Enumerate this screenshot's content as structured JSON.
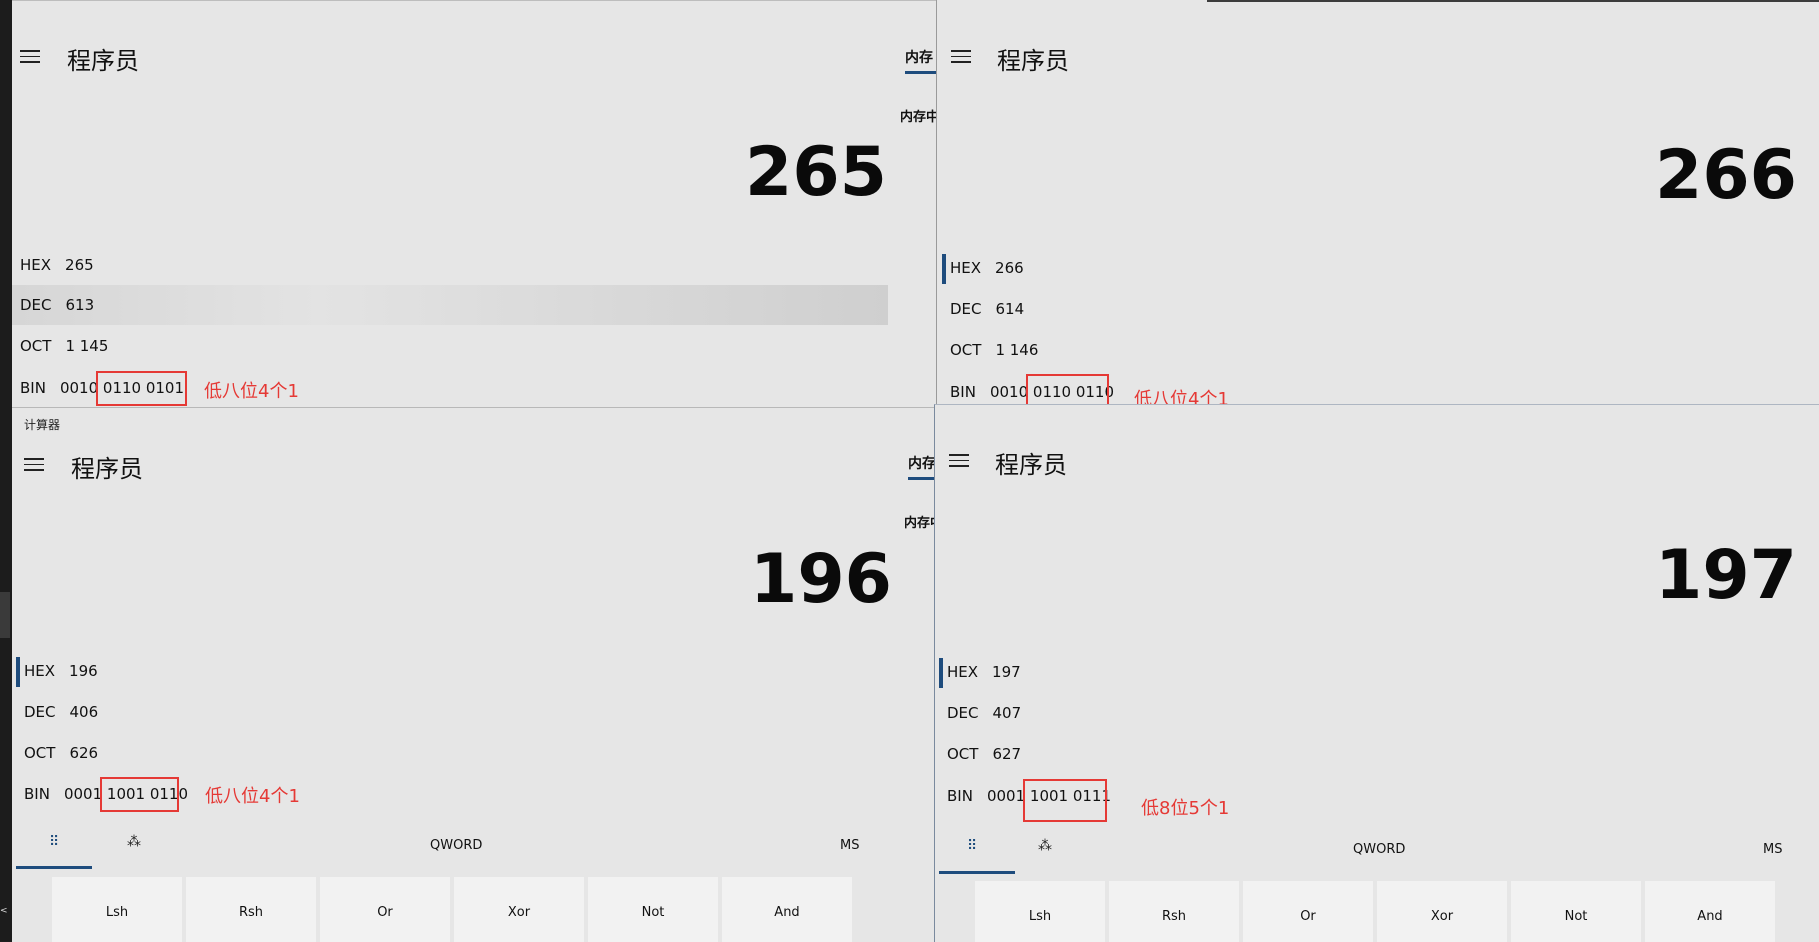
{
  "app_title": "计算器",
  "mode_title": "程序员",
  "memory_tab": "内存",
  "memory_empty": "内存中",
  "labels": {
    "hex": "HEX",
    "dec": "DEC",
    "oct": "OCT",
    "bin": "BIN"
  },
  "panels": {
    "tl": {
      "display": "265",
      "hex": "265",
      "dec": "613",
      "oct": "1 145",
      "bin_high": "0010",
      "bin_low": "0110 0101",
      "annotation": "低八位4个1"
    },
    "tr": {
      "display": "266",
      "hex": "266",
      "dec": "614",
      "oct": "1 146",
      "bin_high": "0010",
      "bin_low": "0110 0110",
      "annotation": "低八位4个1"
    },
    "bl": {
      "display": "196",
      "hex": "196",
      "dec": "406",
      "oct": "626",
      "bin_high": "0001",
      "bin_low": "1001 0110",
      "annotation": "低八位4个1"
    },
    "br": {
      "display": "197",
      "hex": "197",
      "dec": "407",
      "oct": "627",
      "bin_high": "0001",
      "bin_low": "1001 0111",
      "annotation": "低8位5个1"
    }
  },
  "toolbar": {
    "word_size": "QWORD",
    "ms": "MS"
  },
  "keys": [
    "Lsh",
    "Rsh",
    "Or",
    "Xor",
    "Not",
    "And"
  ],
  "colors": {
    "accent": "#1e4c7d",
    "annotation_red": "#e53935",
    "window_bg": "#e6e6e6"
  }
}
